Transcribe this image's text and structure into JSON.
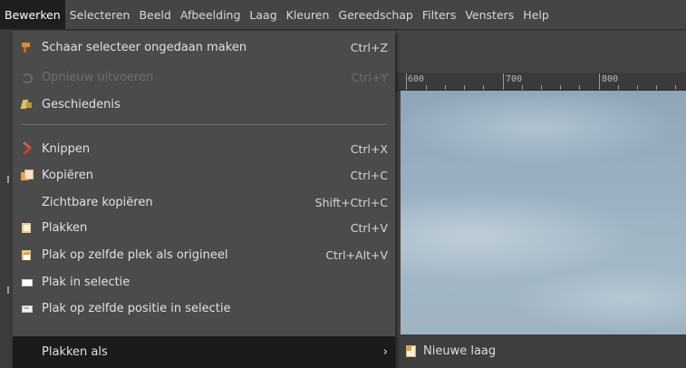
{
  "menubar": {
    "items": [
      {
        "label": "Bewerken",
        "active": true
      },
      {
        "label": "Selecteren"
      },
      {
        "label": "Beeld"
      },
      {
        "label": "Afbeelding"
      },
      {
        "label": "Laag"
      },
      {
        "label": "Kleuren"
      },
      {
        "label": "Gereedschap"
      },
      {
        "label": "Filters"
      },
      {
        "label": "Vensters"
      },
      {
        "label": "Help"
      }
    ]
  },
  "ruler": {
    "labels": [
      "600",
      "700",
      "800"
    ]
  },
  "menu": {
    "items": [
      {
        "label": "Schaar selecteer ongedaan maken",
        "shortcut": "Ctrl+Z",
        "icon": "scissors-icon"
      },
      {
        "label": "Opnieuw uitvoeren",
        "shortcut": "Ctrl+Y",
        "icon": "redo-icon",
        "disabled": true
      },
      {
        "label": "Geschiedenis",
        "shortcut": "",
        "icon": "history-icon"
      },
      {
        "label": "Knippen",
        "shortcut": "Ctrl+X",
        "icon": "cut-icon"
      },
      {
        "label": "Kopiëren",
        "shortcut": "Ctrl+C",
        "icon": "copy-icon"
      },
      {
        "label": "Zichtbare kopiëren",
        "shortcut": "Shift+Ctrl+C",
        "icon": ""
      },
      {
        "label": "Plakken",
        "shortcut": "Ctrl+V",
        "icon": "paste-icon"
      },
      {
        "label": "Plak op zelfde plek als origineel",
        "shortcut": "Ctrl+Alt+V",
        "icon": "paste-in-place-icon"
      },
      {
        "label": "Plak in selectie",
        "shortcut": "",
        "icon": "paste-into-selection-icon"
      },
      {
        "label": "Plak op zelfde positie in selectie",
        "shortcut": "",
        "icon": "paste-in-place-selection-icon"
      },
      {
        "label": "Plakken als",
        "shortcut": "",
        "icon": "",
        "submenu": true,
        "selected": true
      }
    ]
  },
  "submenu": {
    "first_item": "Nieuwe laag"
  },
  "colors": {
    "menubar_bg": "#454545",
    "menu_bg": "#4b4b4b",
    "selected_bg": "#1b1b1b",
    "canvas_sky": "#98b0c1"
  }
}
